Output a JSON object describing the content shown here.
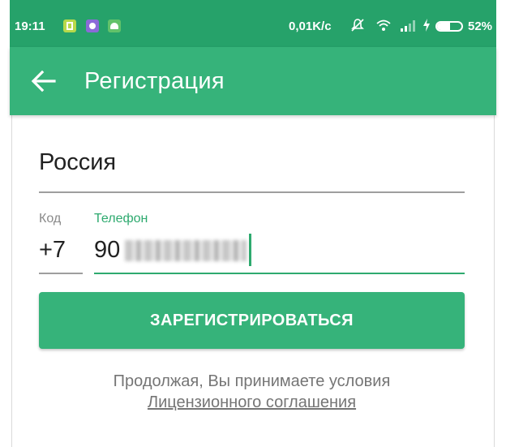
{
  "status_bar": {
    "time": "19:11",
    "network_speed": "0,01K/c",
    "battery_percent": "52%",
    "battery_level": 0.52,
    "icons": [
      "sim-card-icon",
      "viber-icon",
      "android-icon",
      "silent-icon",
      "wifi-icon",
      "signal-icon",
      "charging-icon",
      "battery-icon"
    ]
  },
  "app_bar": {
    "title": "Регистрация",
    "back_icon": "arrow-left-icon"
  },
  "form": {
    "country": "Россия",
    "code_label": "Код",
    "code_value": "+7",
    "phone_label": "Телефон",
    "phone_value_visible": "90"
  },
  "register_button": {
    "label": "ЗАРЕГИСТРИРОВАТЬСЯ"
  },
  "terms": {
    "text": "Продолжая, Вы принимаете условия",
    "link_text": "Лицензионного соглашения"
  },
  "colors": {
    "status_bar": "#26a26a",
    "accent": "#36b37a",
    "field_active": "#2eaa6f",
    "muted_text": "#757575"
  }
}
